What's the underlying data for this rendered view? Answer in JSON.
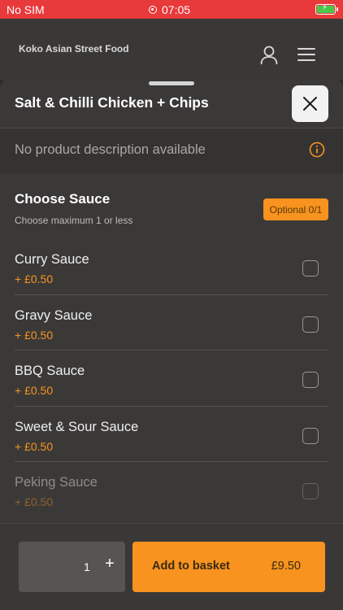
{
  "status_bar": {
    "carrier": "No SIM",
    "time": "07:05"
  },
  "header": {
    "brand": "Koko Asian Street Food"
  },
  "product": {
    "title": "Salt & Chilli Chicken + Chips",
    "description": "No product description available"
  },
  "modifier_group": {
    "title": "Choose Sauce",
    "subtitle": "Choose maximum 1 or less",
    "badge": "Optional 0/1",
    "options": [
      {
        "name": "Curry Sauce",
        "price": "+ £0.50",
        "checked": false
      },
      {
        "name": "Gravy Sauce",
        "price": "+ £0.50",
        "checked": false
      },
      {
        "name": "BBQ Sauce",
        "price": "+ £0.50",
        "checked": false
      },
      {
        "name": "Sweet & Sour Sauce",
        "price": "+ £0.50",
        "checked": false
      },
      {
        "name": "Peking Sauce",
        "price": "+ £0.50",
        "checked": false
      }
    ]
  },
  "footer": {
    "quantity": "1",
    "plus": "+",
    "add_label": "Add to basket",
    "total": "£9.50"
  },
  "colors": {
    "accent": "#f7931e",
    "status_bar": "#e8393b",
    "background": "#3b3938",
    "battery": "#48c94a"
  },
  "icons": [
    "record-icon",
    "battery-icon",
    "user-icon",
    "menu-icon",
    "close-icon",
    "info-icon",
    "checkbox"
  ]
}
